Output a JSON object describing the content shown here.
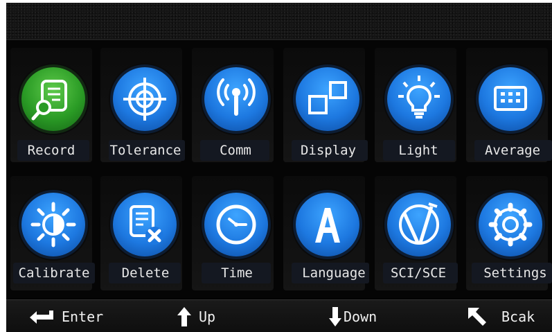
{
  "menu": {
    "row1": [
      {
        "label": "Record",
        "icon": "record-magnifier-icon"
      },
      {
        "label": "Tolerance",
        "icon": "crosshair-target-icon"
      },
      {
        "label": "Comm",
        "icon": "wireless-signal-icon"
      },
      {
        "label": "Display",
        "icon": "display-squares-icon"
      },
      {
        "label": "Light",
        "icon": "light-bulb-icon"
      },
      {
        "label": "Average",
        "icon": "keypad-grid-icon"
      }
    ],
    "row2": [
      {
        "label": "Calibrate",
        "icon": "brightness-sun-icon"
      },
      {
        "label": "Delete",
        "icon": "delete-document-icon"
      },
      {
        "label": "Time",
        "icon": "clock-icon"
      },
      {
        "label": "Language",
        "icon": "letter-a-icon"
      },
      {
        "label": "SCI/SCE",
        "icon": "sci-sce-icon"
      },
      {
        "label": "Settings",
        "icon": "gear-icon"
      }
    ]
  },
  "footer": {
    "enter": "Enter",
    "up": "Up",
    "down": "Down",
    "back": "Bcak"
  },
  "colors": {
    "active_icon": "#2a9b25",
    "icon_blue": "#1d78e0",
    "background": "#000000",
    "text": "#e8e8e8"
  }
}
